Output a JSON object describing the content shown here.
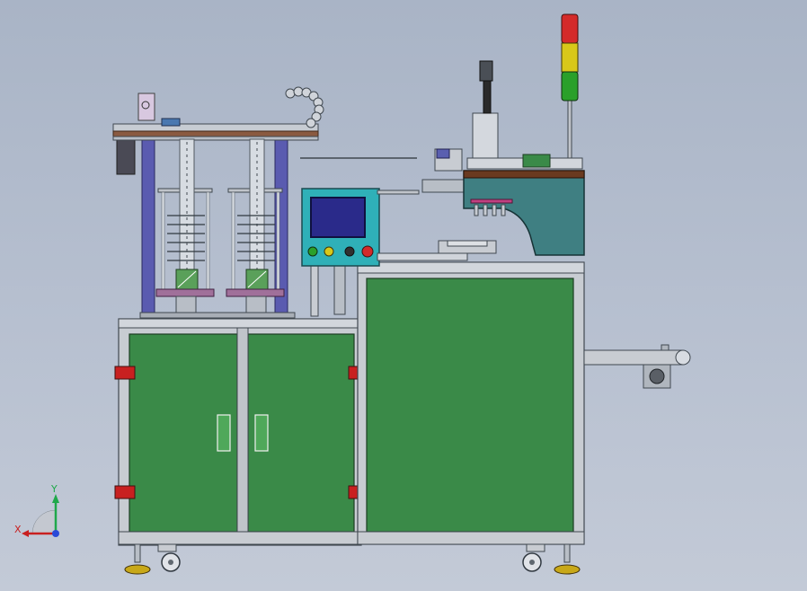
{
  "colors": {
    "background": "#b4bdcc",
    "panel_green": "#3a8a48",
    "frame_gray": "#c8ccd2",
    "column_blue": "#5c5cb0",
    "press_teal": "#3f7f82",
    "hmi_teal": "#2fb0b8",
    "screen_blue": "#2a2a8a",
    "tower_red": "#d42a2a",
    "tower_yellow": "#d8c81a",
    "tower_green": "#2aa02a",
    "bracket_red": "#c82020"
  },
  "icons": {
    "triad": "xyz-coordinate-triad-icon",
    "tower_light": "stack-signal-light-icon"
  },
  "triad": {
    "x_label": "X",
    "y_label": "Y"
  }
}
